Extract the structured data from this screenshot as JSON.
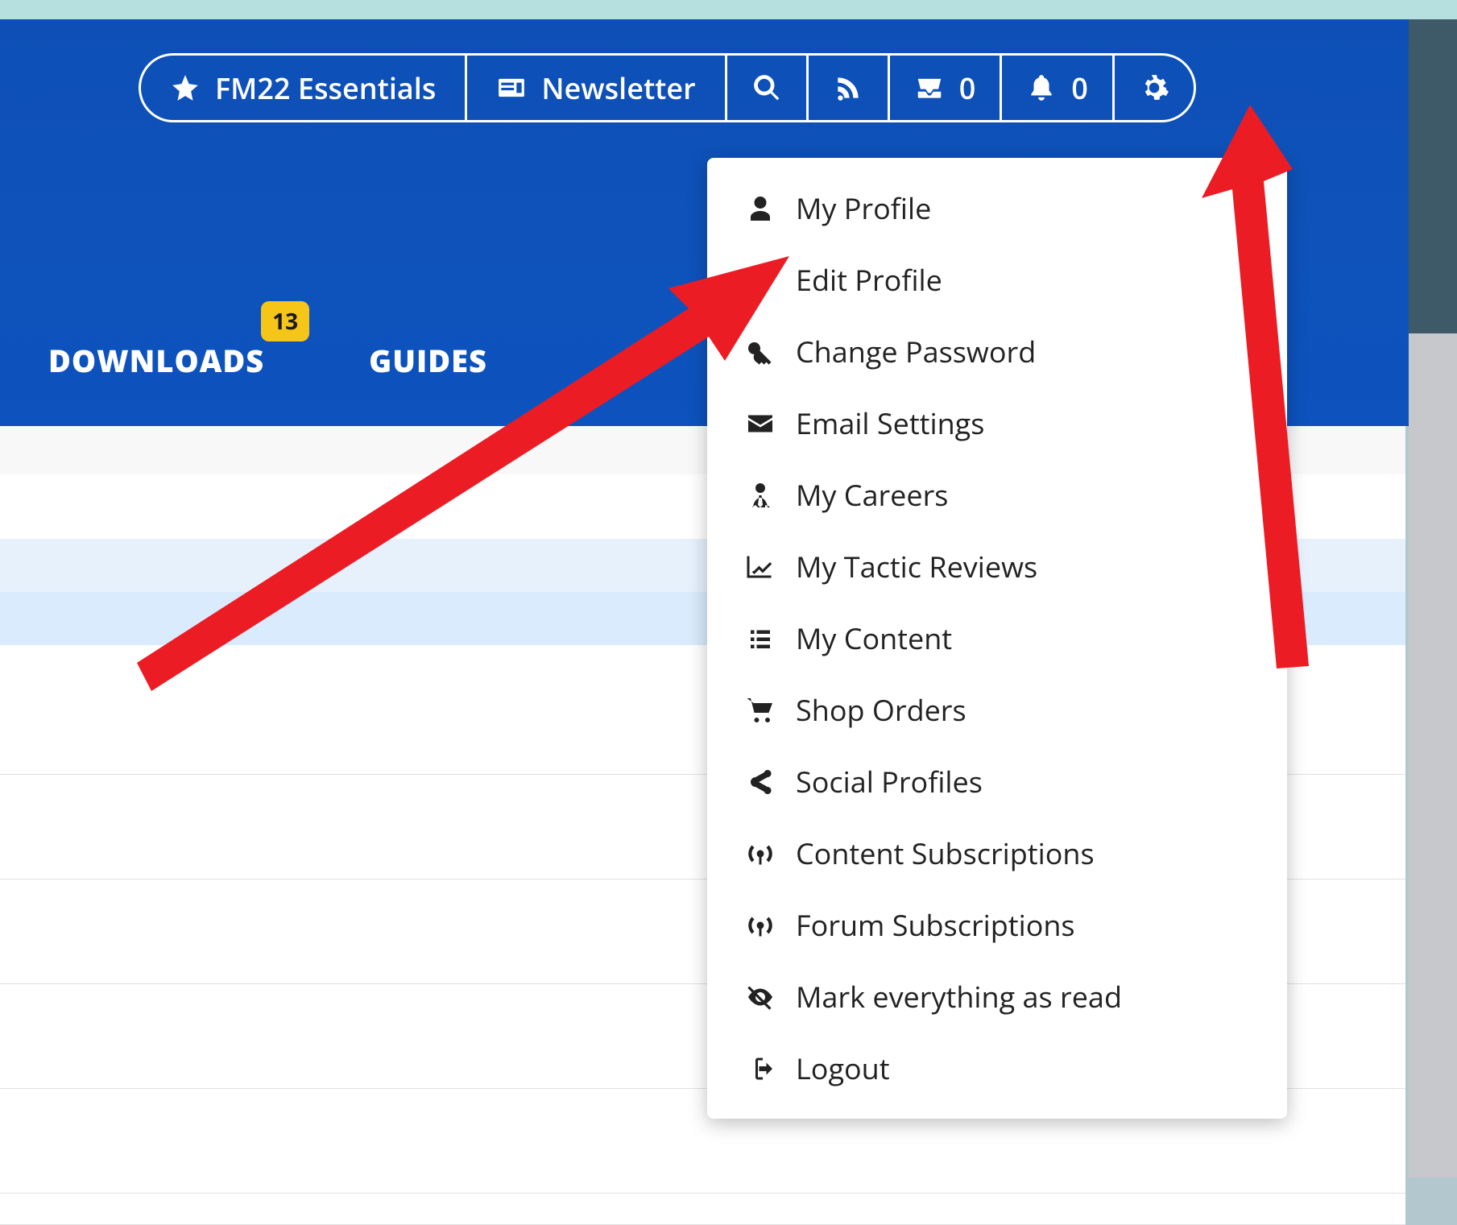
{
  "toolbar": {
    "essentials_label": "FM22 Essentials",
    "newsletter_label": "Newsletter",
    "inbox_count": "0",
    "notifications_count": "0"
  },
  "nav": {
    "downloads_label": "DOWNLOADS",
    "downloads_badge": "13",
    "guides_label": "GUIDES"
  },
  "dropdown": {
    "items": [
      {
        "label": "My Profile"
      },
      {
        "label": "Edit Profile"
      },
      {
        "label": "Change Password"
      },
      {
        "label": "Email Settings"
      },
      {
        "label": "My Careers"
      },
      {
        "label": "My Tactic Reviews"
      },
      {
        "label": "My Content"
      },
      {
        "label": "Shop Orders"
      },
      {
        "label": "Social Profiles"
      },
      {
        "label": "Content Subscriptions"
      },
      {
        "label": "Forum Subscriptions"
      },
      {
        "label": "Mark everything as read"
      },
      {
        "label": "Logout"
      }
    ]
  }
}
